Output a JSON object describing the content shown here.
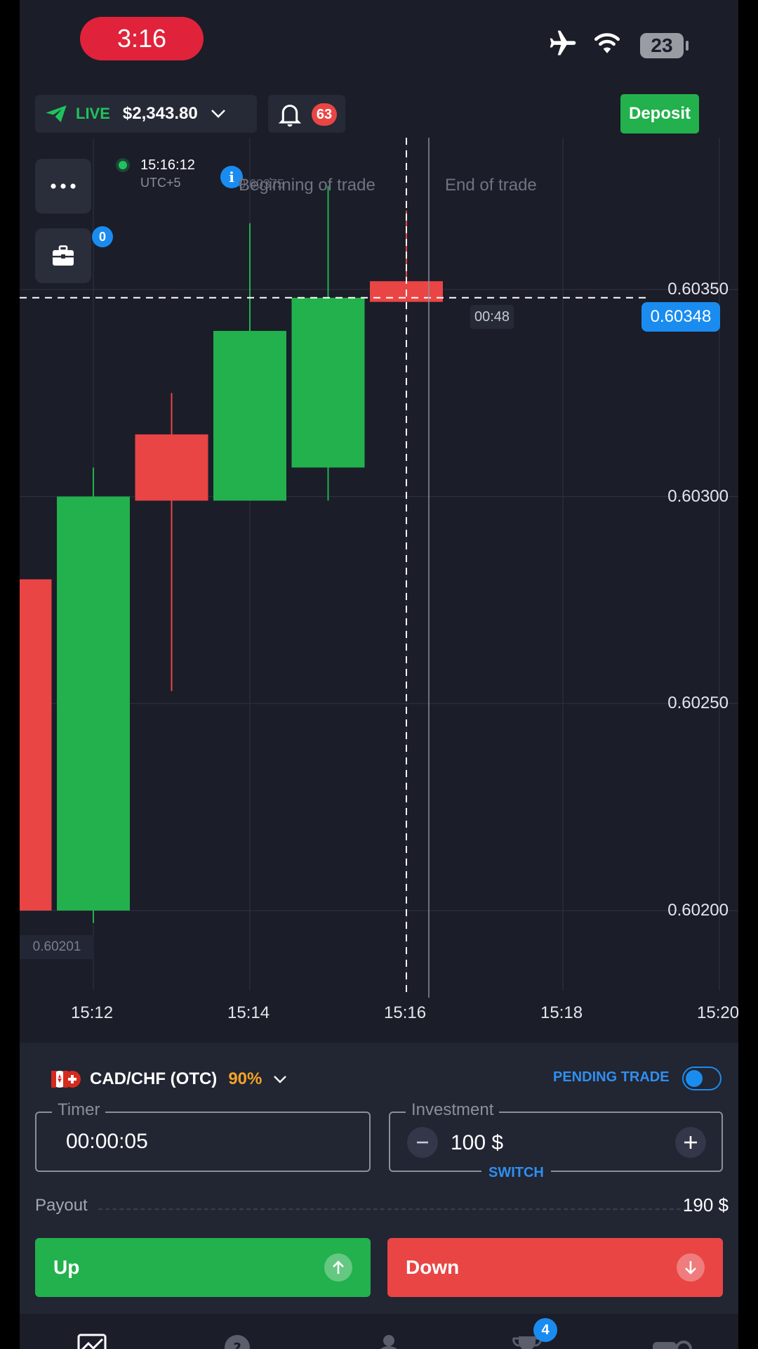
{
  "status_bar": {
    "time": "3:16",
    "battery": "23"
  },
  "account": {
    "mode": "LIVE",
    "balance": "$2,343.80"
  },
  "notifications": {
    "count": "63"
  },
  "deposit_label": "Deposit",
  "portfolio_badge": "0",
  "clock": {
    "time": "15:16:12",
    "timezone": "UTC+5"
  },
  "chart_overlay": {
    "beginning_label": "Beginning of trade",
    "end_label": "End of trade",
    "ghost_price": "0.60375",
    "current_price": "0.60348",
    "countdown": "00:48",
    "low_price": "0.60201"
  },
  "chart_data": {
    "type": "candlestick",
    "y_ticks": [
      "0.60350",
      "0.60300",
      "0.60250",
      "0.60200"
    ],
    "x_ticks": [
      "15:12",
      "15:14",
      "15:16",
      "15:18",
      "15:20"
    ],
    "candles": [
      {
        "time": "15:11",
        "open": 0.6028,
        "close": 0.602,
        "high": 0.6028,
        "low": 0.60195,
        "color": "#e94545"
      },
      {
        "time": "15:12",
        "open": 0.602,
        "close": 0.603,
        "high": 0.60307,
        "low": 0.60197,
        "color": "#22b14c"
      },
      {
        "time": "15:13",
        "open": 0.60315,
        "close": 0.60299,
        "high": 0.60325,
        "low": 0.60253,
        "color": "#e94545"
      },
      {
        "time": "15:14",
        "open": 0.60299,
        "close": 0.6034,
        "high": 0.60366,
        "low": 0.60299,
        "color": "#22b14c"
      },
      {
        "time": "15:15",
        "open": 0.60307,
        "close": 0.60348,
        "high": 0.60375,
        "low": 0.60299,
        "color": "#22b14c"
      },
      {
        "time": "15:16",
        "open": 0.60352,
        "close": 0.60347,
        "high": 0.60369,
        "low": 0.60347,
        "color": "#e94545"
      }
    ],
    "current_price": 0.60348,
    "trade_begin_time": "15:16",
    "grid": true
  },
  "asset": {
    "name": "CAD/CHF (OTC)",
    "payout_pct": "90%"
  },
  "pending_trade_label": "PENDING TRADE",
  "timer": {
    "label": "Timer",
    "value": "00:00:05"
  },
  "investment": {
    "label": "Investment",
    "value": "100 $",
    "switch_label": "SWITCH"
  },
  "payout": {
    "label": "Payout",
    "value": "190 $"
  },
  "buttons": {
    "up": "Up",
    "down": "Down"
  },
  "nav": {
    "tournament_badge": "4"
  },
  "colors": {
    "up": "#22b14c",
    "down": "#e94545",
    "accent": "#1a8cf0",
    "background": "#1b1d29"
  }
}
